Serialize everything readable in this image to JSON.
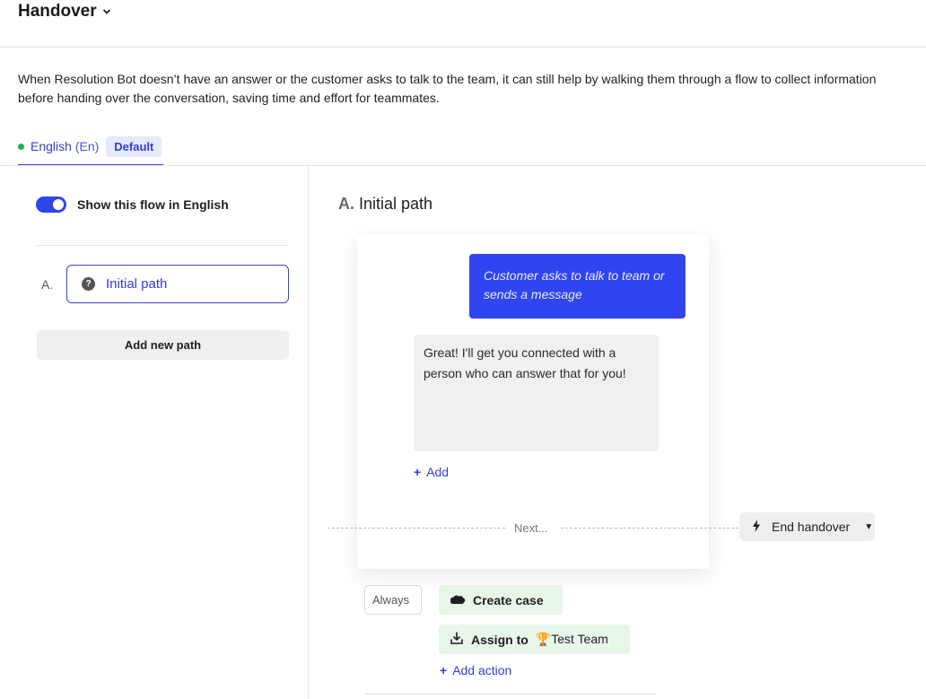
{
  "header": {
    "title": "Handover"
  },
  "description": "When Resolution Bot doesn’t have an answer or the customer asks to talk to the team, it can still help by walking them through a flow to collect information\nbefore handing over the conversation, saving time and effort for teammates.",
  "language_tab": {
    "name": "English",
    "code": "(En)",
    "badge": "Default",
    "status_color": "#23b04b"
  },
  "sidebar": {
    "toggle_label": "Show this flow in English",
    "toggle_on": true,
    "paths": [
      {
        "letter": "A.",
        "name": "Initial path",
        "icon": "question-icon"
      }
    ],
    "add_path_label": "Add new path"
  },
  "main": {
    "section_letter": "A.",
    "section_title": "Initial path",
    "user_message": "Customer asks to talk to team or sends a message",
    "bot_message": "Great! I'll get you connected with a person who can answer that for you!",
    "add_label": "Add",
    "next_label": "Next...",
    "end_button_label": "End handover",
    "condition_label": "Always",
    "actions": [
      {
        "icon": "salesforce-cloud-icon",
        "label": "Create case"
      },
      {
        "icon": "assign-icon",
        "label": "Assign to",
        "target_emoji": "🏆",
        "target": "Test Team"
      }
    ],
    "add_action_label": "Add action"
  },
  "colors": {
    "accent": "#3044f0",
    "link": "#2f3fd6",
    "action_bg": "#e8f5e9"
  }
}
